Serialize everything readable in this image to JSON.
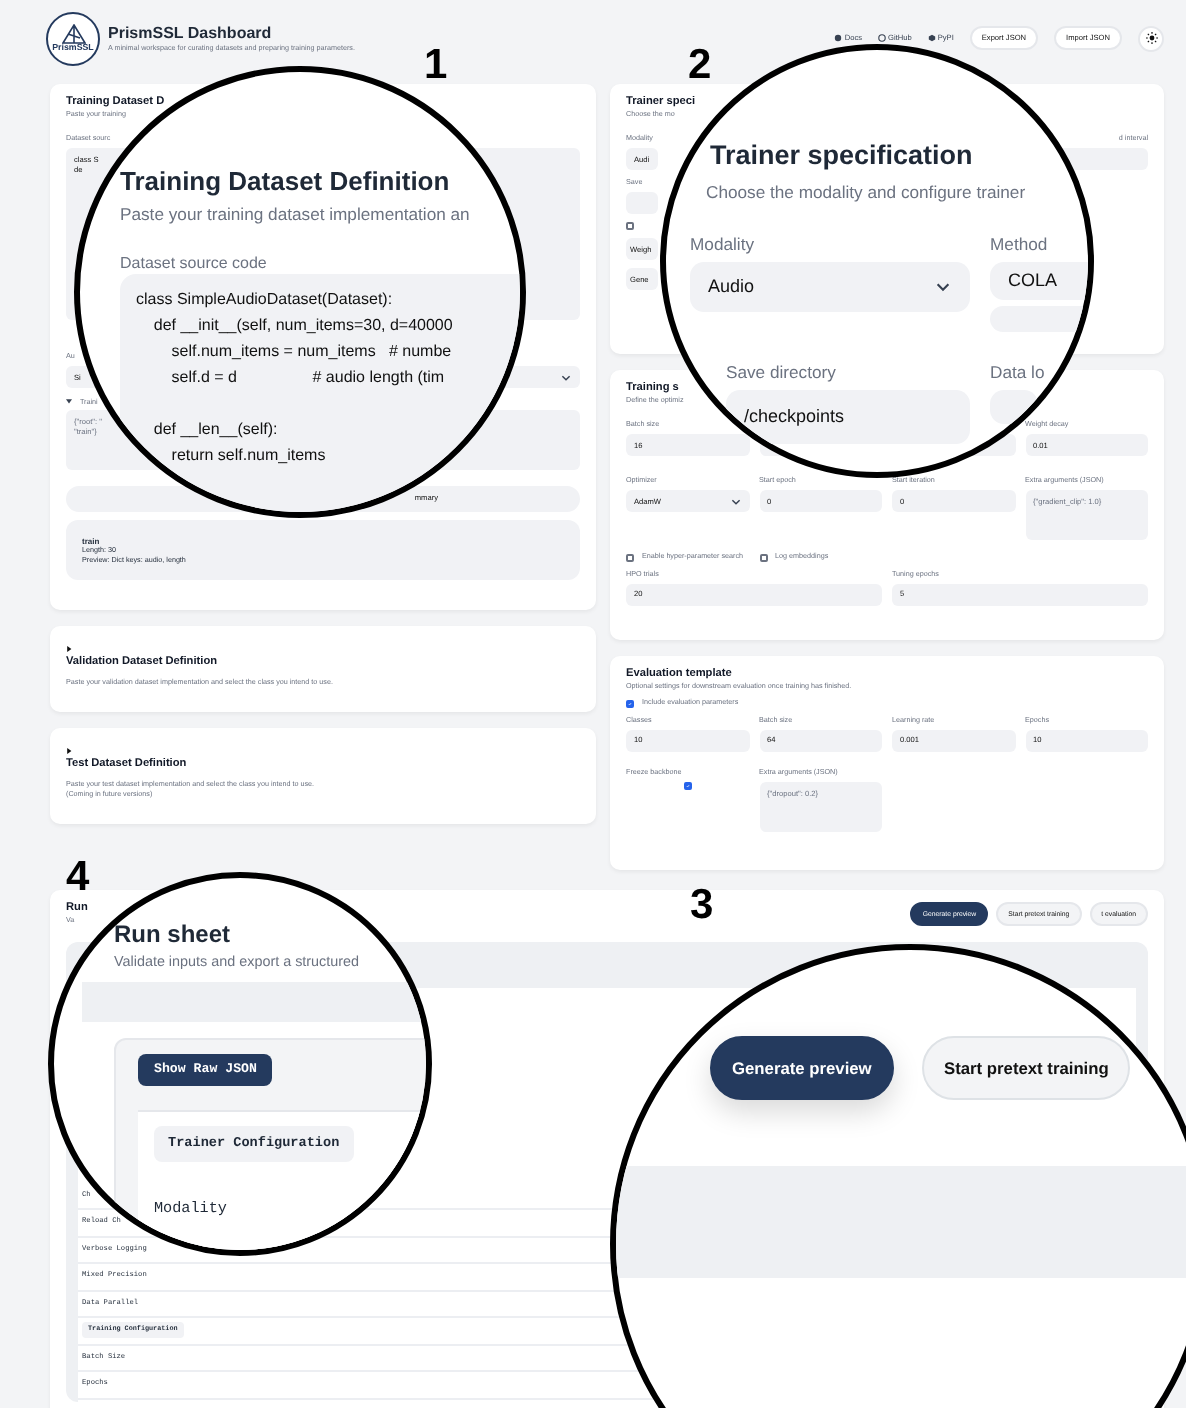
{
  "header": {
    "logo_text": "PrismSSL",
    "title": "PrismSSL Dashboard",
    "subtitle": "A minimal workspace for curating datasets and preparing training parameters.",
    "links": [
      "Docs",
      "GitHub",
      "PyPI"
    ],
    "buttons": [
      "Export JSON",
      "Import JSON"
    ]
  },
  "training_dataset": {
    "title": "Training Dataset D",
    "subtitle": "Paste your training",
    "source_label": "Dataset sourc",
    "code_lines": [
      "class S",
      "de"
    ],
    "class_label": "Au",
    "class_value": "Si",
    "transforms_label": "Traini",
    "transforms_expanded": true,
    "transforms_lines": [
      "{\"root\": \"",
      "\"train\"}"
    ],
    "summary_button": "mmary",
    "summary": {
      "split": "train",
      "lines": [
        "Length: 30",
        "Preview: Dict keys: audio, length"
      ]
    }
  },
  "collapsed_sections": [
    {
      "title": "Validation Dataset Definition",
      "expanded": false,
      "description": "Paste your validation dataset implementation and select the class you intend to use."
    },
    {
      "title": "Test Dataset Definition",
      "expanded": false,
      "description": "Paste your test dataset implementation and select the class you intend to use.",
      "note": "(Coming in future versions)"
    }
  ],
  "trainer_spec": {
    "title": "Trainer speci",
    "subtitle": "Choose the mo",
    "left_fields": [
      {
        "label": "Modality",
        "value": "Audi",
        "kind": "input"
      },
      {
        "label": "Save",
        "kind": "input"
      }
    ],
    "checkbox": {
      "checked": false
    },
    "left_inputs": [
      "Weigh",
      "Gene"
    ],
    "right_label": "d interval"
  },
  "training_settings": {
    "title": "Training s",
    "subtitle": "Define the optimiz",
    "row_1": [
      {
        "label": "Batch size",
        "value": "16",
        "kind": "input"
      },
      {
        "kind": "input"
      },
      {
        "kind": "input"
      },
      {
        "label": "Weight decay",
        "value": "0.01",
        "kind": "input"
      }
    ],
    "row_2": [
      {
        "label": "Optimizer",
        "value": "AdamW",
        "kind": "select"
      },
      {
        "label": "Start epoch",
        "value": "0",
        "kind": "input"
      },
      {
        "label": "Start iteration",
        "value": "0",
        "kind": "input"
      },
      {
        "label": "Extra arguments (JSON)",
        "value": "{\"gradient_clip\": 1.0}",
        "kind": "textarea"
      }
    ],
    "checkboxes": [
      {
        "label": "Enable hyper-parameter search",
        "checked": false
      },
      {
        "label": "Log embeddings",
        "checked": false
      }
    ],
    "row_3": [
      {
        "label": "HPO trials",
        "value": "20",
        "kind": "input"
      },
      {
        "label": "Tuning epochs",
        "value": "5",
        "kind": "input"
      }
    ]
  },
  "evaluation": {
    "title": "Evaluation template",
    "subtitle": "Optional settings for downstream evaluation once training has finished.",
    "include": {
      "label": "Include evaluation parameters",
      "checked": true
    },
    "fields": [
      {
        "label": "Classes",
        "value": "10",
        "kind": "input"
      },
      {
        "label": "Batch size",
        "value": "64",
        "kind": "input"
      },
      {
        "label": "Learning rate",
        "value": "0.001",
        "kind": "input"
      },
      {
        "label": "Epochs",
        "value": "10",
        "kind": "input"
      }
    ],
    "freeze_backbone": {
      "label": "Freeze backbone",
      "checked": true
    },
    "extra": {
      "label": "Extra arguments (JSON)",
      "value": "{\"dropout\": 0.2}"
    }
  },
  "run_sheet": {
    "title": "Run",
    "subtitle": "Va",
    "actions": [
      {
        "label": "Generate preview",
        "primary": true
      },
      {
        "label": "Start pretext training",
        "primary": false
      },
      {
        "label": "t evaluation",
        "primary": false
      }
    ],
    "rows": [
      {
        "kind": "row",
        "label": "Ch"
      },
      {
        "kind": "row",
        "label": "Reload Ch"
      },
      {
        "kind": "row",
        "label": "Verbose Logging"
      },
      {
        "kind": "row",
        "label": "Mixed Precision"
      },
      {
        "kind": "row",
        "label": "Data Parallel"
      },
      {
        "kind": "section",
        "label": "Training Configuration"
      },
      {
        "kind": "row",
        "label": "Batch Size"
      },
      {
        "kind": "row",
        "label": "Epochs"
      }
    ]
  },
  "callouts": [
    {
      "number": "1",
      "kind": "dataset",
      "title": "Training Dataset Definition",
      "subtitle": "Paste your training dataset implementation an",
      "source_label": "Dataset source code",
      "code_blocks": [
        [
          "class SimpleAudioDataset(Dataset):",
          "    def __init__(self, num_items=30, d=40000",
          "        self.num_items = num_items   # numbe",
          "        self.d = d                 # audio length (tim"
        ],
        [
          "    def __len__(self):",
          "        return self.num_items"
        ]
      ]
    },
    {
      "number": "2",
      "kind": "trainer",
      "title": "Trainer specification",
      "subtitle": "Choose the modality and configure trainer",
      "fields": [
        {
          "label": "Modality",
          "value": "Audio",
          "kind": "select"
        },
        {
          "label": "Method",
          "value": "COLA",
          "kind": "input"
        },
        {
          "label": "Save directory",
          "value": "/checkpoints",
          "kind": "input"
        },
        {
          "label": "Data lo",
          "kind": "input"
        }
      ]
    },
    {
      "number": "3",
      "kind": "actions",
      "buttons": [
        {
          "label": "Generate preview",
          "primary": true
        },
        {
          "label": "Start pretext training",
          "primary": false
        }
      ]
    },
    {
      "number": "4",
      "kind": "run_sheet",
      "title": "Run sheet",
      "subtitle": "Validate inputs and export a structured",
      "button": "Show Raw JSON",
      "section": "Trainer Configuration",
      "row_label": "Modality"
    }
  ]
}
